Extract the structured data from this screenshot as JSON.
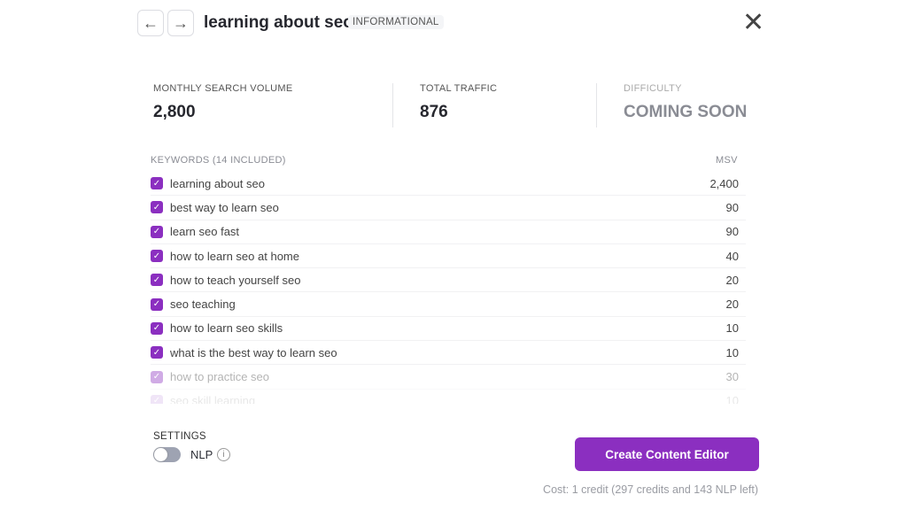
{
  "header": {
    "back_icon": "arrow-left-icon",
    "forward_icon": "arrow-right-icon",
    "title": "learning about seo",
    "badge": "INFORMATIONAL",
    "close_icon": "close-icon"
  },
  "stats": [
    {
      "label": "MONTHLY SEARCH VOLUME",
      "value": "2,800"
    },
    {
      "label": "TOTAL TRAFFIC",
      "value": "876"
    },
    {
      "label": "DIFFICULTY",
      "value": "COMING SOON"
    }
  ],
  "keywords": {
    "header": "KEYWORDS (14 INCLUDED)",
    "msv_header": "MSV",
    "accent": "#8b2fc0",
    "items": [
      {
        "text": "learning about seo",
        "msv": "2,400",
        "checked": true
      },
      {
        "text": "best way to learn seo",
        "msv": "90",
        "checked": true
      },
      {
        "text": "learn seo fast",
        "msv": "90",
        "checked": true
      },
      {
        "text": "how to learn seo at home",
        "msv": "40",
        "checked": true
      },
      {
        "text": "how to teach yourself seo",
        "msv": "20",
        "checked": true
      },
      {
        "text": "seo teaching",
        "msv": "20",
        "checked": true
      },
      {
        "text": "how to learn seo skills",
        "msv": "10",
        "checked": true
      },
      {
        "text": "what is the best way to learn seo",
        "msv": "10",
        "checked": true
      },
      {
        "text": "how to practice seo",
        "msv": "30",
        "checked": true
      },
      {
        "text": "seo skill learning",
        "msv": "10",
        "checked": true
      }
    ]
  },
  "settings": {
    "label": "SETTINGS",
    "nlp_label": "NLP",
    "nlp_enabled": false
  },
  "action": {
    "button": "Create Content Editor",
    "cost": "Cost: 1 credit (297 credits and 143 NLP left)"
  }
}
